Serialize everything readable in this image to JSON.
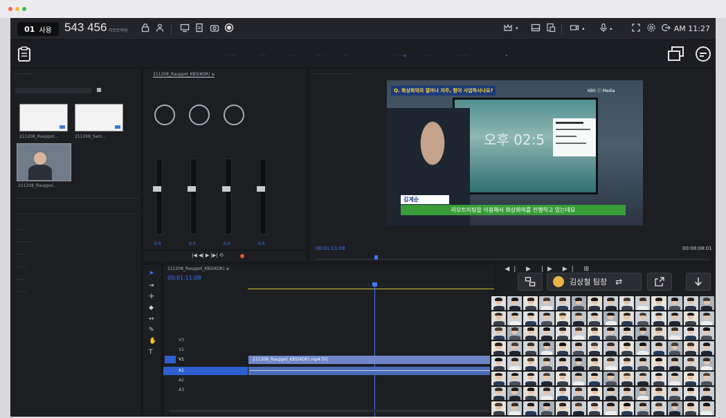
{
  "header": {
    "room_number_badge": "01",
    "room_badge_text": "사용",
    "room_id": "543 456",
    "room_label": "리모트미팅",
    "time": "AM 11:27"
  },
  "icons": {
    "lock": "lock-icon",
    "users": "users-icon",
    "screen": "monitor-icon",
    "doc": "document-icon",
    "camera": "camera-icon",
    "record": "record-icon",
    "crown": "crown-icon",
    "layout": "layout-icon",
    "share": "share-icon",
    "video": "video-icon",
    "mic": "mic-icon",
    "fullscreen": "fullscreen-icon",
    "settings": "gear-icon",
    "exit": "exit-icon",
    "clipboard": "clipboard-icon",
    "window": "window-icon",
    "chat": "chat-icon",
    "arrow_down": "arrow-down-icon",
    "swap": "swap-icon",
    "popout": "popout-icon",
    "pip": "pip-icon"
  },
  "premiere": {
    "timecode_program": "00:01:11:08",
    "timecode_end": "00:08:08:01",
    "timecode_timeline": "00:01:11:08",
    "sequence_tab": "211208_Rauppol_KBS(KOR) ≡",
    "sequence_name": "211208_Rauppol_KBS(KOR).mp4 [V]",
    "bin_item_1": "211208_Rauppol...",
    "bin_item_2": "211208_Sam...",
    "bin_item_3": "211208_Rauppol...",
    "tracks": [
      {
        "label": "V3"
      },
      {
        "label": "V2"
      },
      {
        "label": "V1"
      },
      {
        "label": "A1"
      },
      {
        "label": "A2"
      },
      {
        "label": "A3"
      }
    ],
    "mixer_levels": [
      "0.0",
      "0.0",
      "0.0",
      "0.0"
    ]
  },
  "program_video": {
    "question": "Q. 화상회의의 열마나 자주, 함이 사업하시나요?",
    "logo": "KBS ⓒ Media",
    "speaker_name": "김계순",
    "subtitle": "리모트미팅을 이용해서 화상회의를 진행하고 있는데요",
    "time_overlay": "오후 02:5"
  },
  "floating": {
    "presenter_name": "김상철 팀장"
  },
  "colors": {
    "accent_blue": "#3e78ff",
    "clip_blue": "#6f86c9",
    "subtitle_green": "#3a9d3a",
    "question_yellow": "#ffd640"
  }
}
